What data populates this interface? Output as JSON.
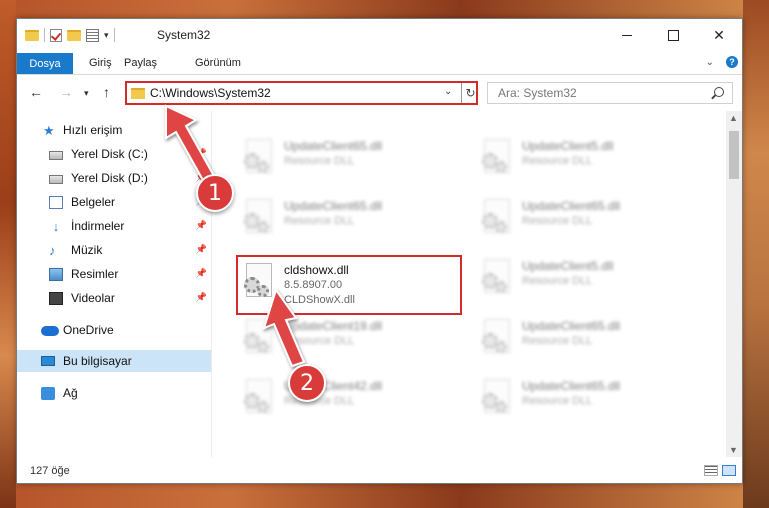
{
  "window": {
    "title": "System32",
    "controls": [
      "minimize",
      "maximize",
      "close"
    ]
  },
  "ribbon": {
    "tabs": [
      {
        "label": "Dosya",
        "active": true
      },
      {
        "label": "Giriş"
      },
      {
        "label": "Paylaş"
      },
      {
        "label": "Görünüm"
      }
    ]
  },
  "navbar": {
    "address": "C:\\Windows\\System32",
    "search_placeholder": "Ara: System32"
  },
  "sidebar": {
    "items": [
      {
        "label": "Hızlı erişim",
        "icon": "star-icon"
      },
      {
        "label": "Yerel Disk (C:)",
        "icon": "drive-icon",
        "pinned": true
      },
      {
        "label": "Yerel Disk (D:)",
        "icon": "drive-icon",
        "pinned": true
      },
      {
        "label": "Belgeler",
        "icon": "documents-icon",
        "pinned": true
      },
      {
        "label": "İndirmeler",
        "icon": "downloads-icon",
        "pinned": true
      },
      {
        "label": "Müzik",
        "icon": "music-icon",
        "pinned": true
      },
      {
        "label": "Resimler",
        "icon": "pictures-icon",
        "pinned": true
      },
      {
        "label": "Videolar",
        "icon": "videos-icon",
        "pinned": true
      },
      {
        "label": "OneDrive",
        "icon": "onedrive-icon"
      },
      {
        "label": "Bu bilgisayar",
        "icon": "computer-icon",
        "selected": true
      },
      {
        "label": "Ağ",
        "icon": "network-icon"
      }
    ]
  },
  "files": [
    {
      "name": "UpdateClient65.dll",
      "type": "Resource DLL"
    },
    {
      "name": "UpdateClient5.dll",
      "type": "Resource DLL"
    },
    {
      "name": "UpdateClient65.dll",
      "type": "Resource DLL"
    },
    {
      "name": "UpdateClient65.dll",
      "type": "Resource DLL"
    },
    {
      "name": "cldshowx.dll",
      "version": "8.5.8907.00",
      "description": "CLDShowX.dll",
      "highlighted": true
    },
    {
      "name": "UpdateClient5.dll",
      "type": "Resource DLL"
    },
    {
      "name": "UpdateClient19.dll",
      "type": "Resource DLL"
    },
    {
      "name": "UpdateClient65.dll",
      "type": "Resource DLL"
    },
    {
      "name": "UpdateClient42.dll",
      "type": "Resource DLL"
    },
    {
      "name": "UpdateClient65.dll",
      "type": "Resource DLL"
    }
  ],
  "status": {
    "item_count": "127 öğe"
  },
  "annotations": [
    {
      "number": "1"
    },
    {
      "number": "2"
    }
  ],
  "colors": {
    "accent": "#1979ca",
    "highlight": "#d32a2a",
    "selected": "#cce4f7"
  }
}
